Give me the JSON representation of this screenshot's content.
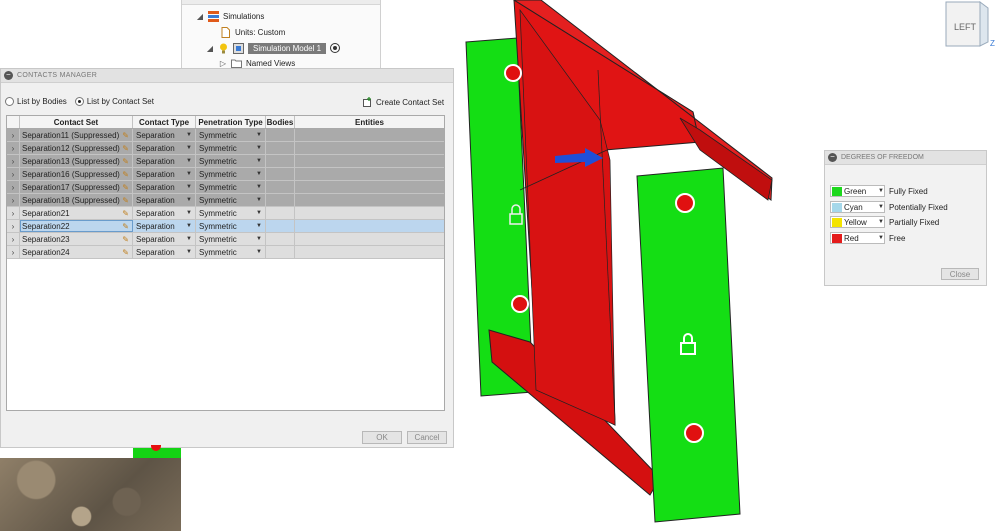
{
  "browser": {
    "items": [
      {
        "label": "Simulations"
      },
      {
        "label": "Units: Custom"
      },
      {
        "label": "Simulation Model 1"
      },
      {
        "label": "Named Views"
      }
    ]
  },
  "contacts_manager": {
    "title": "CONTACTS MANAGER",
    "options": {
      "list_by_bodies": "List by Bodies",
      "list_by_contact_set": "List by Contact Set",
      "selected": "List by Contact Set"
    },
    "create_label": "Create Contact Set",
    "columns": [
      "Contact Set",
      "Contact Type",
      "Penetration Type",
      "Bodies",
      "Entities"
    ],
    "rows": [
      {
        "name": "Separation11 (Suppressed)",
        "type": "Separation",
        "penetration": "Symmetric",
        "state": "suppressed"
      },
      {
        "name": "Separation12 (Suppressed)",
        "type": "Separation",
        "penetration": "Symmetric",
        "state": "suppressed"
      },
      {
        "name": "Separation13 (Suppressed)",
        "type": "Separation",
        "penetration": "Symmetric",
        "state": "suppressed"
      },
      {
        "name": "Separation16 (Suppressed)",
        "type": "Separation",
        "penetration": "Symmetric",
        "state": "suppressed"
      },
      {
        "name": "Separation17 (Suppressed)",
        "type": "Separation",
        "penetration": "Symmetric",
        "state": "suppressed"
      },
      {
        "name": "Separation18 (Suppressed)",
        "type": "Separation",
        "penetration": "Symmetric",
        "state": "suppressed"
      },
      {
        "name": "Separation21",
        "type": "Separation",
        "penetration": "Symmetric",
        "state": "normal"
      },
      {
        "name": "Separation22",
        "type": "Separation",
        "penetration": "Symmetric",
        "state": "selected"
      },
      {
        "name": "Separation23",
        "type": "Separation",
        "penetration": "Symmetric",
        "state": "normal"
      },
      {
        "name": "Separation24",
        "type": "Separation",
        "penetration": "Symmetric",
        "state": "normal"
      }
    ],
    "ok_label": "OK",
    "cancel_label": "Cancel"
  },
  "dof": {
    "title": "DEGREES OF FREEDOM",
    "items": [
      {
        "color_name": "Green",
        "color": "#1ed81e",
        "meaning": "Fully Fixed"
      },
      {
        "color_name": "Cyan",
        "color": "#a6d8ea",
        "meaning": "Potentially Fixed"
      },
      {
        "color_name": "Yellow",
        "color": "#f4e400",
        "meaning": "Partially Fixed"
      },
      {
        "color_name": "Red",
        "color": "#e41b1b",
        "meaning": "Free"
      }
    ],
    "close_label": "Close"
  },
  "viewcube": {
    "face": "LEFT",
    "axis": "Z"
  },
  "colors": {
    "model_red": "#e01414",
    "model_green": "#14de14",
    "arrow_blue": "#1f4fd8"
  }
}
